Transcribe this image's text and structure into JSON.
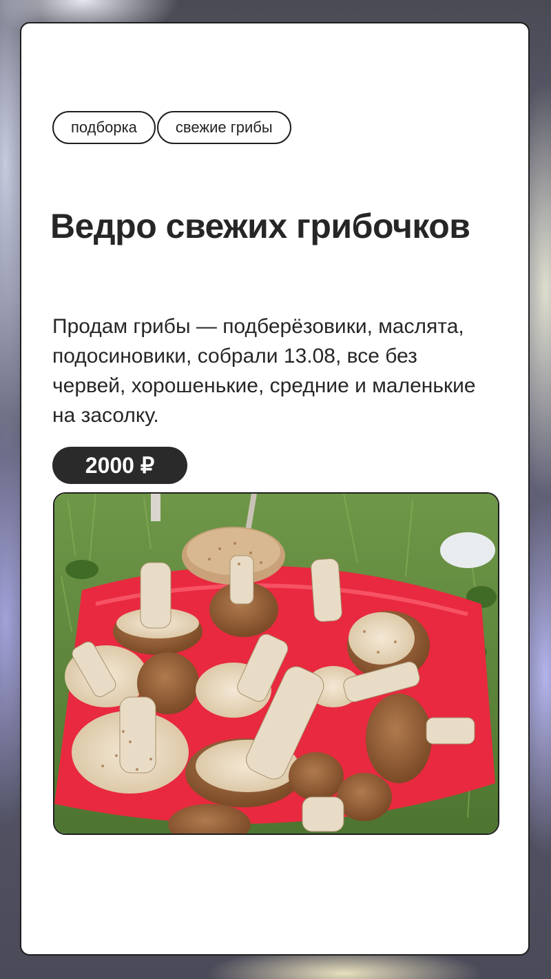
{
  "card": {
    "tags": [
      "подборка",
      "свежие грибы"
    ],
    "title": "Ведро свежих грибочков",
    "description": "Продам грибы — подберёзовики, маслята, подосиновики, собрали 13.08, все без червей, хорошенькие, средние и маленькие на засолку.",
    "price": "2000 ₽"
  },
  "colors": {
    "accent": "#2a2a2a",
    "bucket": "#e8293f",
    "grass": "#5e8a3a"
  }
}
